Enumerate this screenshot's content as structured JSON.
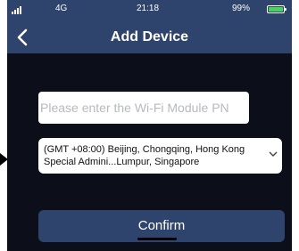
{
  "status_bar": {
    "network": "4G",
    "time": "21:18",
    "battery_percent": "99%",
    "battery_level": 0.99,
    "battery_color": "#47d45b"
  },
  "nav": {
    "title": "Add Device",
    "back_icon": "chevron-left-icon"
  },
  "form": {
    "pn_input": {
      "value": "",
      "placeholder": "Please enter the Wi-Fi Module PN"
    },
    "timezone": {
      "selected": "(GMT +08:00) Beijing, Chongqing, Hong Kong Special Admini...Lumpur, Singapore",
      "icon": "chevron-down-icon"
    },
    "confirm_label": "Confirm"
  },
  "colors": {
    "header": "#2f446c",
    "background": "#0c0f1a",
    "button": "#2f446c"
  }
}
